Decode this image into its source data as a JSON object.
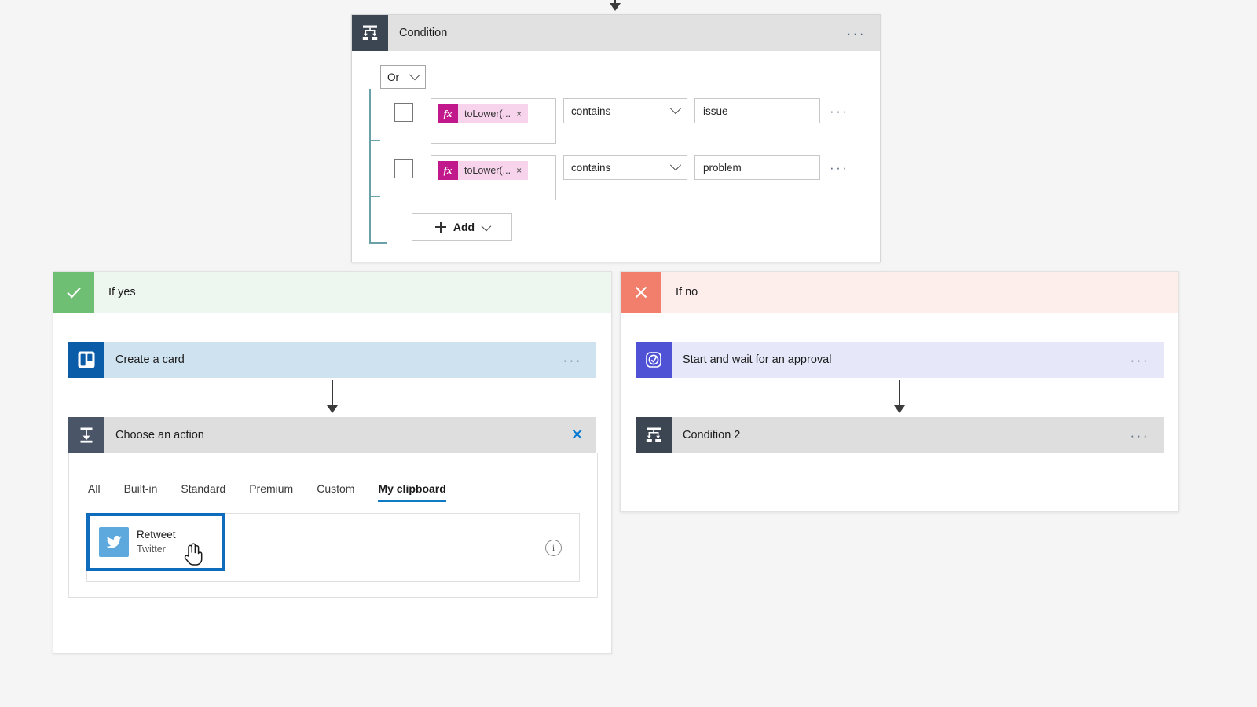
{
  "condition_card": {
    "title": "Condition",
    "icon": "condition-icon",
    "menu": "···",
    "logic_operator": "Or",
    "rows": [
      {
        "token_label": "toLower(...",
        "token_remove": "×",
        "fx_label": "fx",
        "operator": "contains",
        "value": "issue",
        "menu": "···"
      },
      {
        "token_label": "toLower(...",
        "token_remove": "×",
        "fx_label": "fx",
        "operator": "contains",
        "value": "problem",
        "menu": "···"
      }
    ],
    "add_button": "Add"
  },
  "yes_branch": {
    "label": "If yes",
    "badge_icon": "checkmark-icon",
    "actions": [
      {
        "title": "Create a card",
        "icon": "trello-icon",
        "menu": "···"
      }
    ],
    "choose_action": {
      "title": "Choose an action",
      "icon": "choose-action-icon",
      "close": "✕",
      "tabs": [
        {
          "label": "All",
          "active": false
        },
        {
          "label": "Built-in",
          "active": false
        },
        {
          "label": "Standard",
          "active": false
        },
        {
          "label": "Premium",
          "active": false
        },
        {
          "label": "Custom",
          "active": false
        },
        {
          "label": "My clipboard",
          "active": true
        }
      ],
      "results": [
        {
          "title": "Retweet",
          "subtitle": "Twitter",
          "icon": "twitter-icon",
          "selected": true,
          "info_icon": "info-icon"
        }
      ]
    }
  },
  "no_branch": {
    "label": "If no",
    "badge_icon": "close-icon",
    "actions": [
      {
        "title": "Start and wait for an approval",
        "icon": "approval-icon",
        "menu": "···"
      },
      {
        "title": "Condition 2",
        "icon": "condition-icon",
        "menu": "···"
      }
    ]
  },
  "colors": {
    "canvas_bg": "#f5f5f5",
    "condition_icon_bg": "#3b4652",
    "yes_badge": "#6ebe73",
    "no_badge": "#f27f6c",
    "trello_blue": "#0b5ca8",
    "approval_purple": "#4f52d4",
    "twitter_blue": "#5da9dd",
    "accent_blue": "#0f6cbd",
    "fx_magenta": "#c1198c",
    "token_pink": "#f7d4ec",
    "tree_line": "#6aa0a8"
  }
}
